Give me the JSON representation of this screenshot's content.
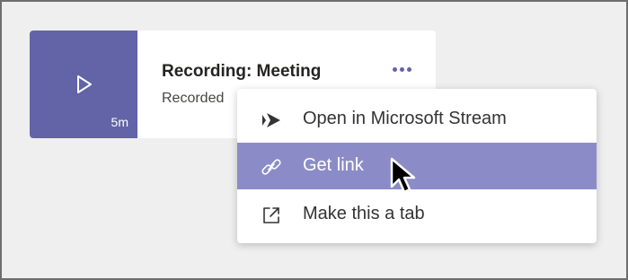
{
  "recording": {
    "title": "Recording: Meeting",
    "subtitle": "Recorded",
    "duration": "5m"
  },
  "context_menu": {
    "items": [
      {
        "label": "Open in Microsoft Stream",
        "icon": "stream-icon",
        "active": false
      },
      {
        "label": "Get link",
        "icon": "link-icon",
        "active": true
      },
      {
        "label": "Make this a tab",
        "icon": "open-external-icon",
        "active": false
      }
    ]
  },
  "colors": {
    "accent": "#6264a7",
    "menu_highlight": "#8b8cc7",
    "background": "#efefef"
  }
}
